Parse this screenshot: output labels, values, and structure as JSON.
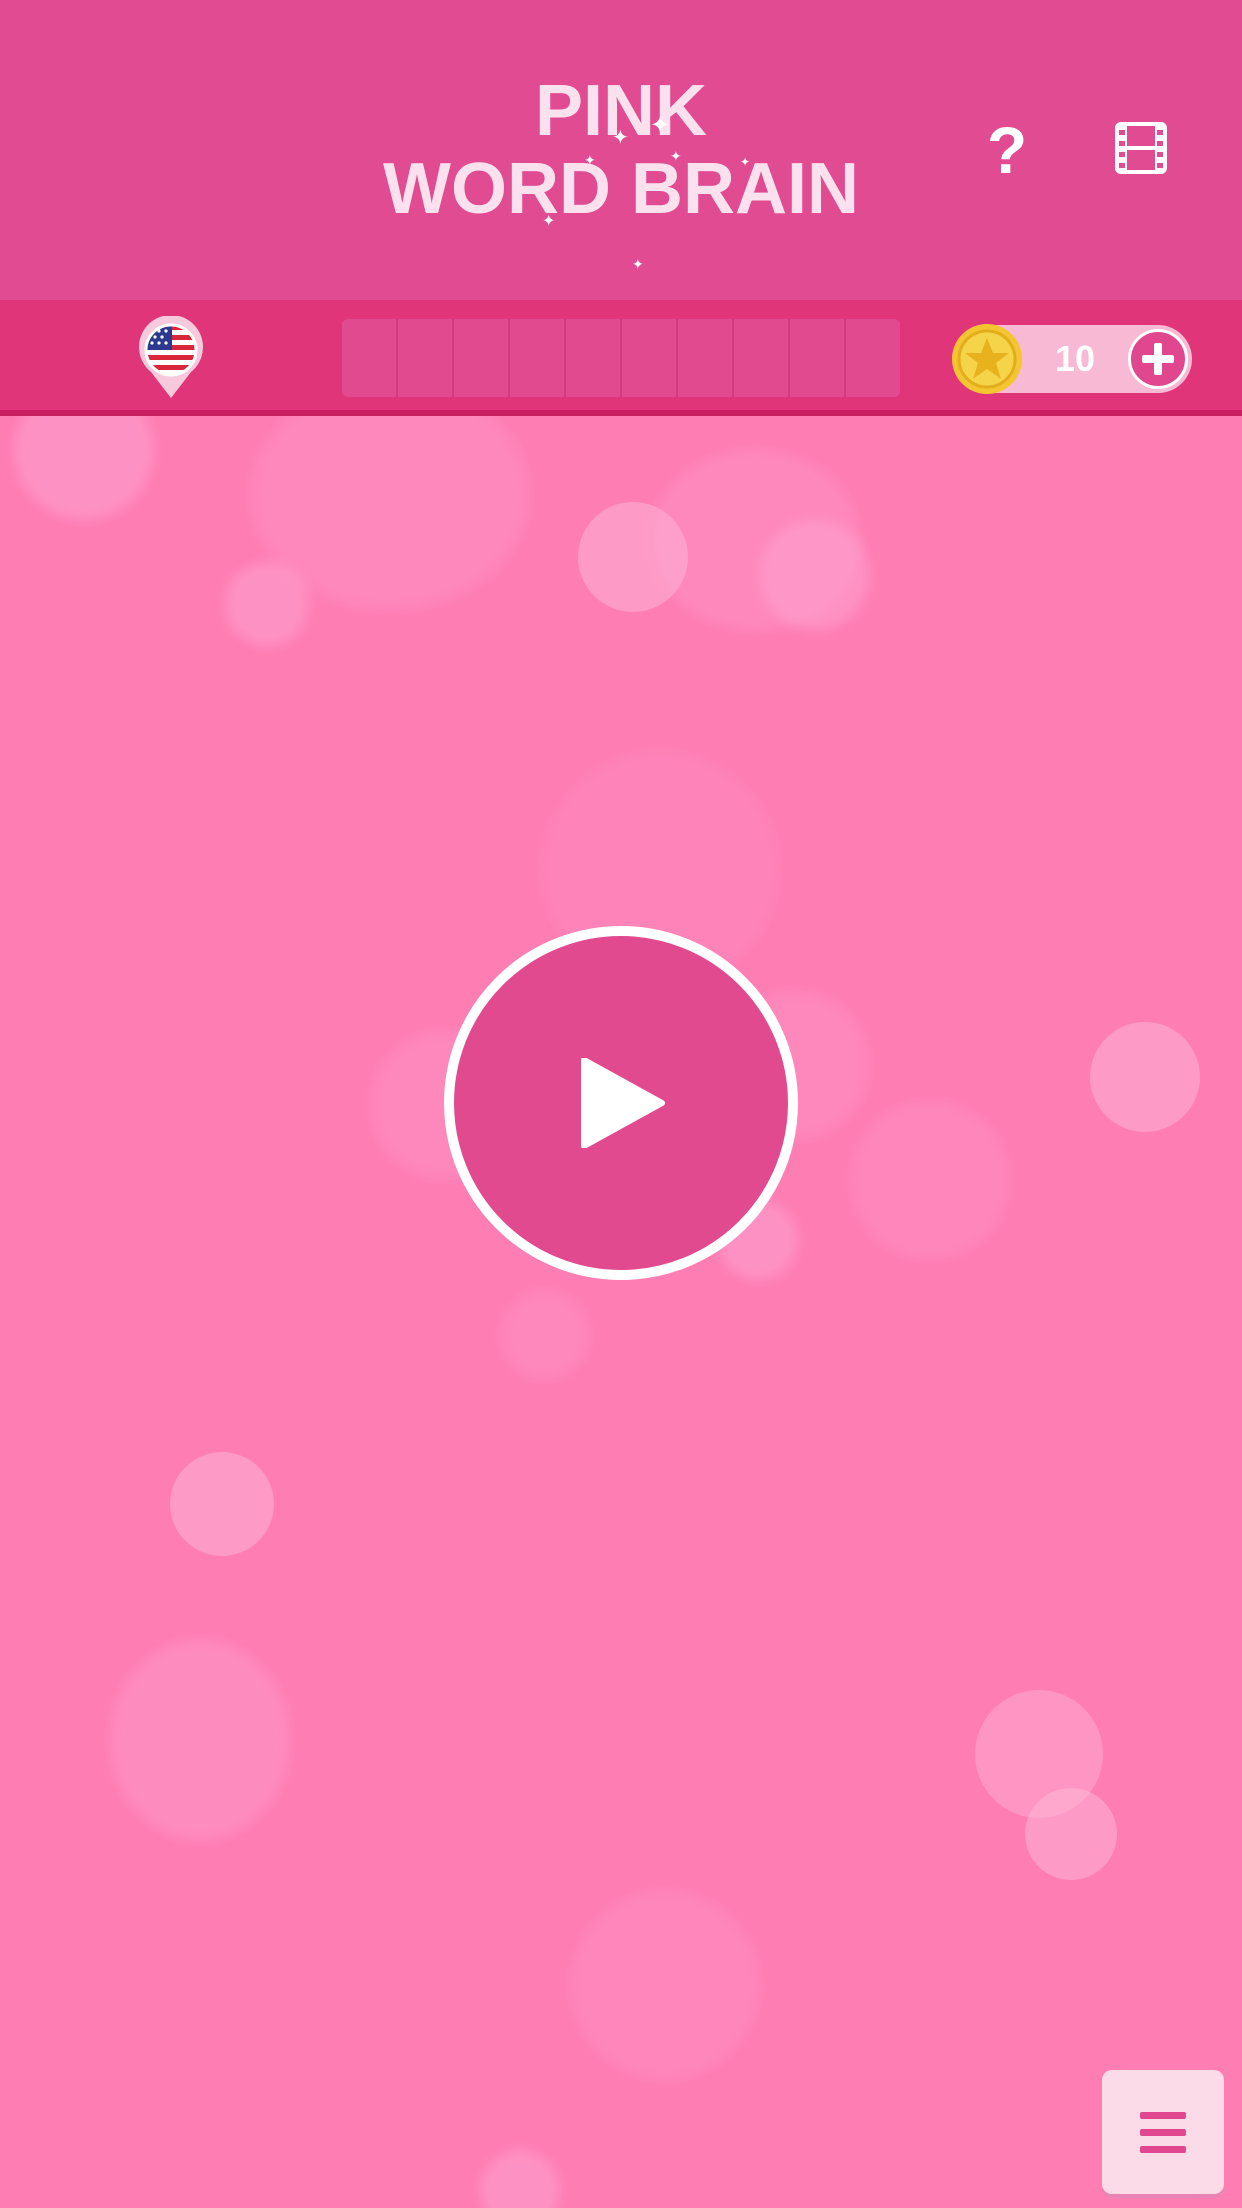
{
  "header": {
    "title_line1": "PINK",
    "title_line2": "WORD BRAIN",
    "help_label": "?",
    "film_icon": "film-icon"
  },
  "statusbar": {
    "language_icon": "us-flag-pin-icon",
    "progress_cells": 10,
    "coins": "10",
    "add_coins_icon": "plus-icon"
  },
  "main": {
    "play_icon": "play-icon",
    "menu_icon": "hamburger-icon"
  },
  "colors": {
    "header": "#e04b91",
    "statusbar": "#e03679",
    "background": "#fe7db3",
    "play_button": "#e24a90",
    "title_text": "#fbe1ee"
  }
}
